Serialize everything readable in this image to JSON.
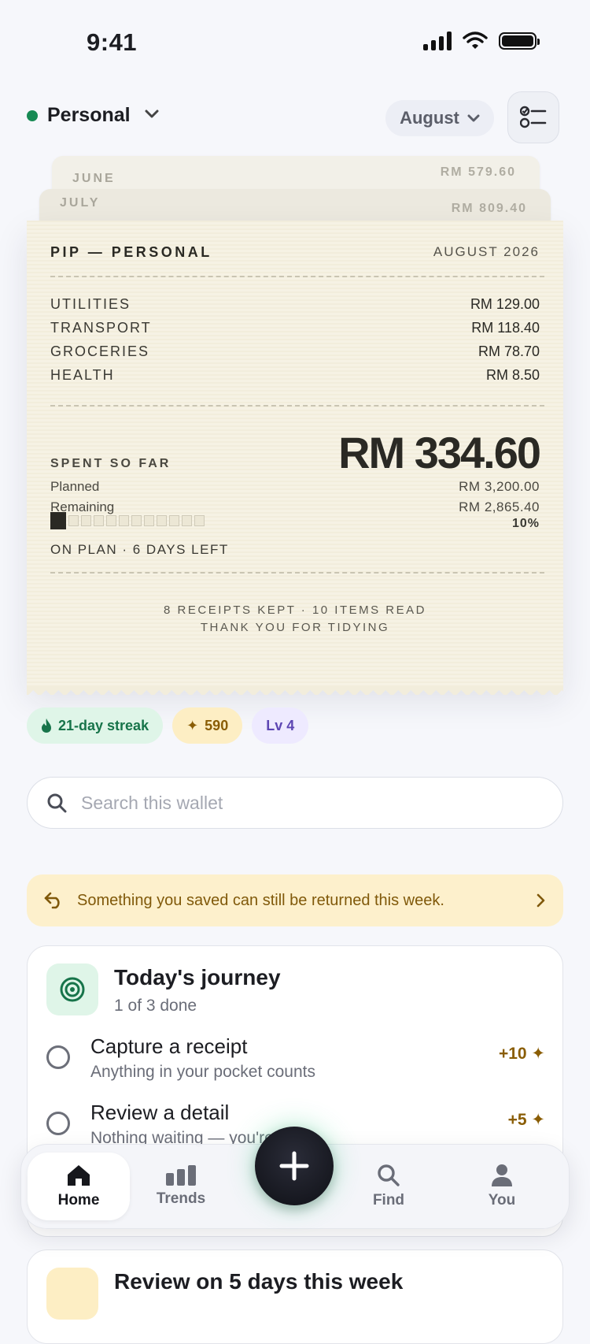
{
  "status": {
    "time": "9:41"
  },
  "header": {
    "wallet_name": "Personal",
    "month": "August"
  },
  "receipt_stack": {
    "back": [
      {
        "month": "JUNE",
        "amount": "RM 579.60"
      },
      {
        "month": "JULY",
        "amount": "RM 809.40"
      }
    ],
    "front": {
      "title": "PIP — PERSONAL",
      "date": "AUGUST 2026",
      "lines": [
        {
          "label": "UTILITIES",
          "amount": "RM 129.00"
        },
        {
          "label": "TRANSPORT",
          "amount": "RM 118.40"
        },
        {
          "label": "GROCERIES",
          "amount": "RM 78.70"
        },
        {
          "label": "HEALTH",
          "amount": "RM 8.50"
        }
      ],
      "spent_label": "SPENT SO FAR",
      "spent_amount": "RM 334.60",
      "planned_label": "Planned",
      "planned_amount": "RM 3,200.00",
      "remaining_label": "Remaining",
      "remaining_amount": "RM 2,865.40",
      "progress_fraction": 0.1,
      "progress_percent": "10%",
      "status": "ON PLAN · 6 DAYS LEFT",
      "footer_line1": "8 RECEIPTS KEPT · 10 ITEMS READ",
      "footer_line2": "THANK YOU FOR TIDYING"
    }
  },
  "chips": {
    "streak": "21-day streak",
    "points": "590",
    "level": "Lv 4"
  },
  "search": {
    "placeholder": "Search this wallet",
    "value": ""
  },
  "banner": {
    "text": "Something you saved can still be returned this week."
  },
  "journey": {
    "title": "Today's journey",
    "subtitle": "1 of 3 done",
    "tasks": [
      {
        "title": "Capture a receipt",
        "subtitle": "Anything in your pocket counts",
        "points": "+10 ✦"
      },
      {
        "title": "Review a detail",
        "subtitle": "Nothing waiting — you're clear",
        "points": "+5 ✦"
      }
    ]
  },
  "next_card": {
    "title": "Review on 5 days this week"
  },
  "tabs": [
    {
      "label": "Home",
      "icon": "home-icon"
    },
    {
      "label": "Trends",
      "icon": "bar-chart-icon"
    },
    {
      "label": "Find",
      "icon": "search-icon"
    },
    {
      "label": "You",
      "icon": "person-icon"
    }
  ],
  "colors": {
    "accent_green": "#178a54",
    "gold": "#8a5d05",
    "violet": "#5d46b3",
    "paper": "#f6f2e4"
  }
}
